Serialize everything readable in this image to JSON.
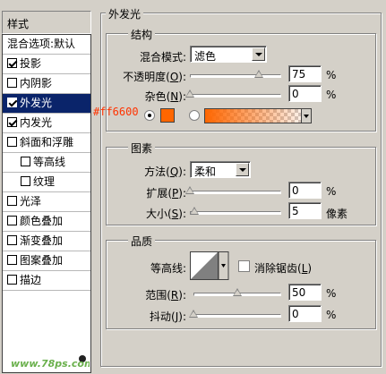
{
  "styles_panel": {
    "header": "样式",
    "items": [
      {
        "label": "混合选项:默认",
        "checkbox": false,
        "checked": false,
        "indent": false,
        "selected": false
      },
      {
        "label": "投影",
        "checkbox": true,
        "checked": true,
        "indent": false,
        "selected": false
      },
      {
        "label": "内阴影",
        "checkbox": true,
        "checked": false,
        "indent": false,
        "selected": false
      },
      {
        "label": "外发光",
        "checkbox": true,
        "checked": true,
        "indent": false,
        "selected": true
      },
      {
        "label": "内发光",
        "checkbox": true,
        "checked": true,
        "indent": false,
        "selected": false
      },
      {
        "label": "斜面和浮雕",
        "checkbox": true,
        "checked": false,
        "indent": false,
        "selected": false
      },
      {
        "label": "等高线",
        "checkbox": true,
        "checked": false,
        "indent": true,
        "selected": false
      },
      {
        "label": "纹理",
        "checkbox": true,
        "checked": false,
        "indent": true,
        "selected": false
      },
      {
        "label": "光泽",
        "checkbox": true,
        "checked": false,
        "indent": false,
        "selected": false
      },
      {
        "label": "颜色叠加",
        "checkbox": true,
        "checked": false,
        "indent": false,
        "selected": false
      },
      {
        "label": "渐变叠加",
        "checkbox": true,
        "checked": false,
        "indent": false,
        "selected": false
      },
      {
        "label": "图案叠加",
        "checkbox": true,
        "checked": false,
        "indent": false,
        "selected": false
      },
      {
        "label": "描边",
        "checkbox": true,
        "checked": false,
        "indent": false,
        "selected": false
      }
    ]
  },
  "outer_glow": {
    "title": "外发光",
    "structure": {
      "title": "结构",
      "blend_mode_label": "混合模式:",
      "blend_mode_value": "滤色",
      "opacity_label": "不透明度(",
      "opacity_key": "O",
      "opacity_value": "75",
      "opacity_percent": 0.75,
      "opacity_unit": "%",
      "noise_label": "杂色(",
      "noise_key": "N",
      "noise_value": "0",
      "noise_percent": 0,
      "noise_unit": "%",
      "color_annotation": "#ff6600",
      "glow_color": "#ff6600"
    },
    "elements": {
      "title": "图素",
      "method_label": "方法(",
      "method_key": "Q",
      "method_value": "柔和",
      "spread_label": "扩展(",
      "spread_key": "P",
      "spread_value": "0",
      "spread_percent": 0,
      "spread_unit": "%",
      "size_label": "大小(",
      "size_key": "S",
      "size_value": "5",
      "size_unit": "像素"
    },
    "quality": {
      "title": "品质",
      "contour_label": "等高线:",
      "antialias_label": "消除锯齿(",
      "antialias_key": "L",
      "range_label": "范围(",
      "range_key": "R",
      "range_value": "50",
      "range_percent": 0.5,
      "range_unit": "%",
      "jitter_label": "抖动(",
      "jitter_key": "J",
      "jitter_value": "0",
      "jitter_percent": 0,
      "jitter_unit": "%"
    }
  },
  "watermark": "www.78ps.com"
}
